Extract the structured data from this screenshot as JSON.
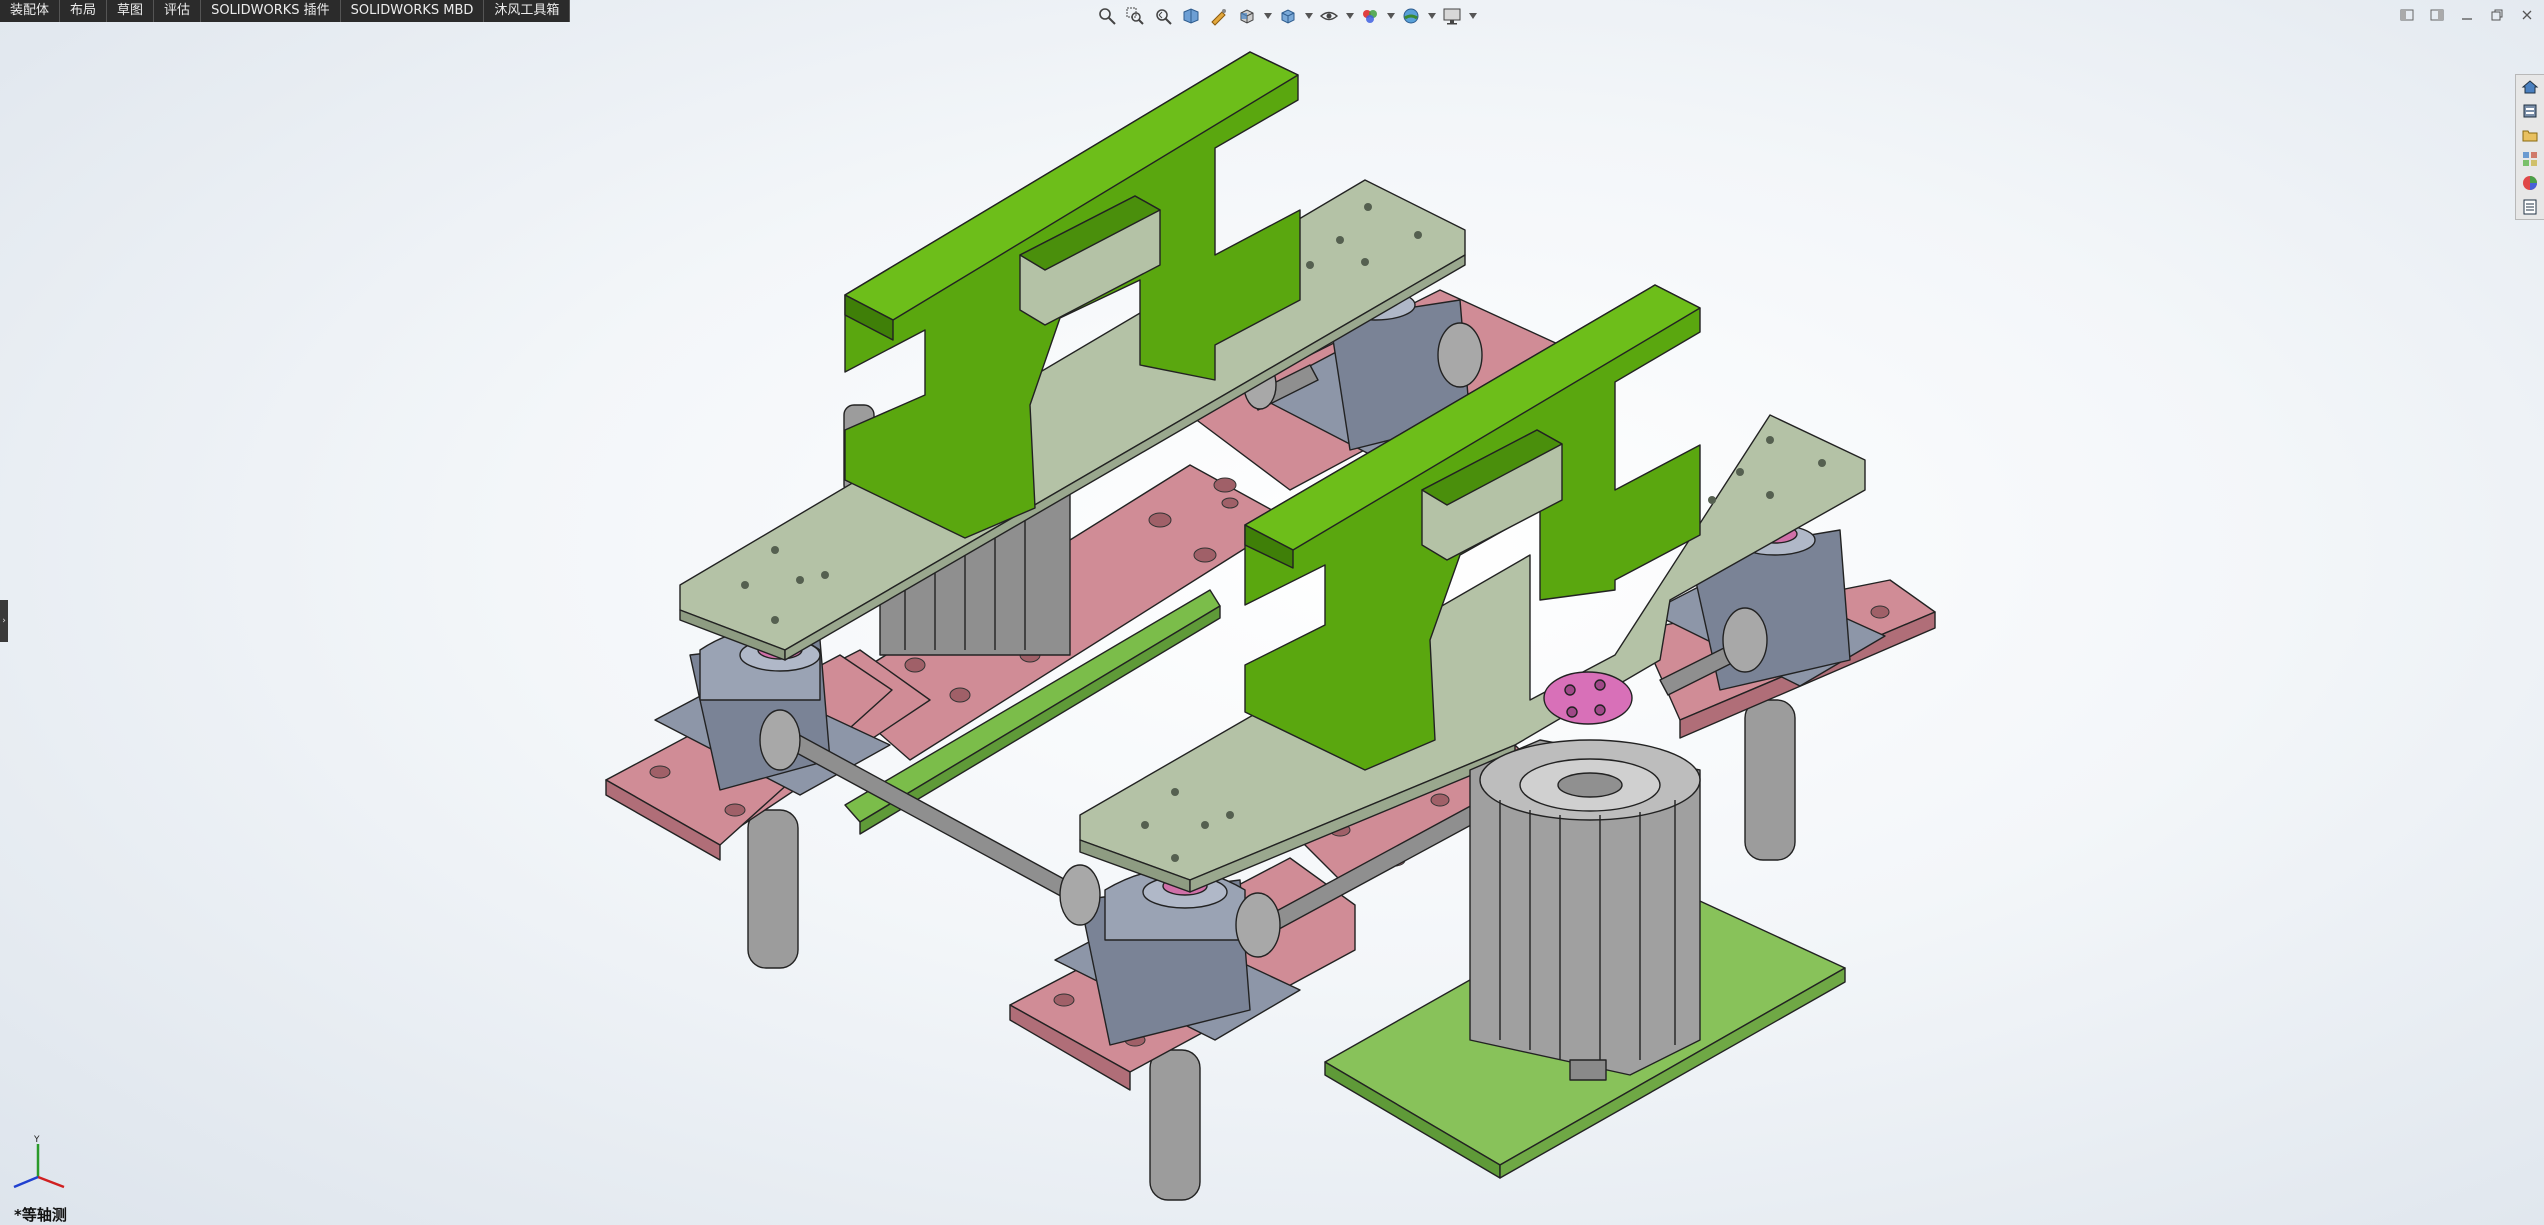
{
  "command_tabs": [
    "装配体",
    "布局",
    "草图",
    "评估",
    "SOLIDWORKS 插件",
    "SOLIDWORKS MBD",
    "沐风工具箱"
  ],
  "view_orientation_label": "*等轴测",
  "triad_axis_label": "Y",
  "icons": {
    "heads_up_toolbar": [
      "zoom-to-fit-icon",
      "zoom-to-area-icon",
      "previous-view-icon",
      "section-view-icon",
      "dynamic-annotation-icon",
      "view-orientation-icon",
      "display-style-icon",
      "hide-show-items-icon",
      "edit-appearance-icon",
      "apply-scene-icon",
      "view-settings-icon"
    ],
    "window_controls": [
      "tile-left-icon",
      "tile-right-icon",
      "minimize-icon",
      "restore-icon",
      "close-icon"
    ],
    "task_pane": [
      "home-icon",
      "design-library-icon",
      "file-explorer-icon",
      "view-palette-icon",
      "appearances-icon",
      "custom-properties-icon"
    ]
  },
  "colors": {
    "part_green": "#5aa70f",
    "plate_grey_green": "#b4c2a6",
    "base_pink": "#d08c96",
    "bearing_blue_grey": "#8d96a8",
    "base_green": "#88c25a",
    "cylinder_grey": "#a0a0a0"
  }
}
